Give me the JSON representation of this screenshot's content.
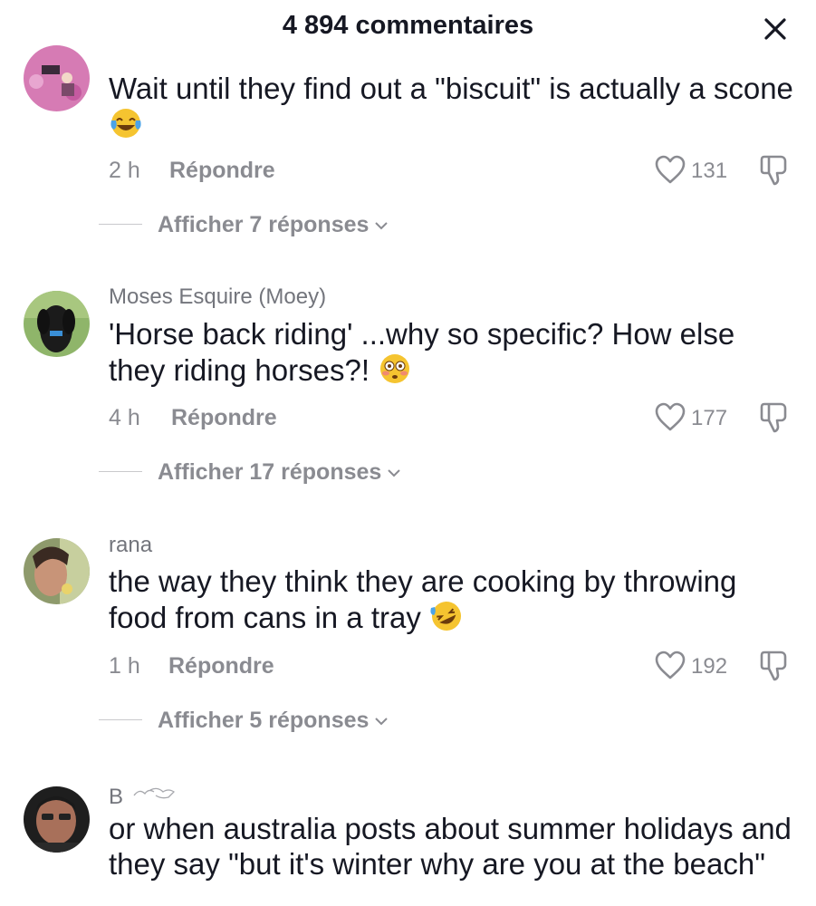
{
  "header": {
    "title": "4 894 commentaires",
    "close_icon": "close-icon"
  },
  "comments": [
    {
      "username": "",
      "text": "Wait until they find out a \"biscuit\" is actually a scone",
      "emoji": "😂",
      "time": "2 h",
      "reply_label": "Répondre",
      "likes": "131",
      "view_replies": "Afficher 7 réponses"
    },
    {
      "username": "Moses Esquire (Moey)",
      "text": "'Horse back riding' ...why so specific? How else they riding horses?!",
      "emoji": "😳",
      "time": "4 h",
      "reply_label": "Répondre",
      "likes": "177",
      "view_replies": "Afficher 17 réponses"
    },
    {
      "username": "rana",
      "text": "the way they think they are cooking by throwing food from cans in a tray",
      "emoji": "🤣",
      "time": "1 h",
      "reply_label": "Répondre",
      "likes": "192",
      "view_replies": "Afficher 5 réponses"
    },
    {
      "username": "B",
      "text": "or when australia posts about summer holidays and they say \"but it's winter why are you at the beach\""
    }
  ],
  "colors": {
    "primary_text": "#161823",
    "secondary_text": "#8a8b91",
    "background": "#ffffff"
  }
}
